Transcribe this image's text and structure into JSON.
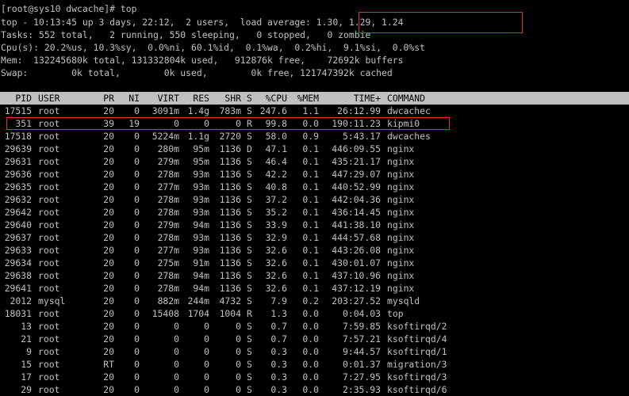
{
  "colors": {
    "background": "#000000",
    "text": "#c0c0c0",
    "header_bg": "#c0c0c0",
    "header_text": "#000000",
    "highlight": "#e03030"
  },
  "prompt": "[root@sys10 dwcache]# top",
  "summary": {
    "top_line": "top - 10:13:45 up 3 days, 22:12,  2 users,  load average: 1.30, 1.29, 1.24",
    "tasks_line": "Tasks: 552 total,   2 running, 550 sleeping,   0 stopped,   0 zombie",
    "cpu_line": "Cpu(s): 20.2%us, 10.3%sy,  0.0%ni, 60.1%id,  0.1%wa,  0.2%hi,  9.1%si,  0.0%st",
    "mem_line": "Mem:  132245680k total, 131332804k used,   912876k free,    72692k buffers",
    "swap_line": "Swap:        0k total,        0k used,        0k free, 121747392k cached"
  },
  "columns": [
    "PID",
    "USER",
    "PR",
    "NI",
    "VIRT",
    "RES",
    "SHR",
    "S",
    "%CPU",
    "%MEM",
    "TIME+",
    "COMMAND"
  ],
  "processes": [
    {
      "pid": "17515",
      "user": "root",
      "pr": "20",
      "ni": "0",
      "virt": "3091m",
      "res": "1.4g",
      "shr": "783m",
      "s": "S",
      "cpu": "247.6",
      "mem": "1.1",
      "time": "26:12.99",
      "command": "dwcachec"
    },
    {
      "pid": "351",
      "user": "root",
      "pr": "39",
      "ni": "19",
      "virt": "0",
      "res": "0",
      "shr": "0",
      "s": "R",
      "cpu": "99.8",
      "mem": "0.0",
      "time": "190:11.23",
      "command": "kipmi0"
    },
    {
      "pid": "17518",
      "user": "root",
      "pr": "20",
      "ni": "0",
      "virt": "5224m",
      "res": "1.1g",
      "shr": "2720",
      "s": "S",
      "cpu": "58.0",
      "mem": "0.9",
      "time": "5:43.17",
      "command": "dwcaches"
    },
    {
      "pid": "29639",
      "user": "root",
      "pr": "20",
      "ni": "0",
      "virt": "280m",
      "res": "95m",
      "shr": "1136",
      "s": "D",
      "cpu": "47.1",
      "mem": "0.1",
      "time": "446:09.55",
      "command": "nginx"
    },
    {
      "pid": "29631",
      "user": "root",
      "pr": "20",
      "ni": "0",
      "virt": "279m",
      "res": "95m",
      "shr": "1136",
      "s": "S",
      "cpu": "46.4",
      "mem": "0.1",
      "time": "435:21.17",
      "command": "nginx"
    },
    {
      "pid": "29636",
      "user": "root",
      "pr": "20",
      "ni": "0",
      "virt": "278m",
      "res": "93m",
      "shr": "1136",
      "s": "S",
      "cpu": "42.2",
      "mem": "0.1",
      "time": "447:29.07",
      "command": "nginx"
    },
    {
      "pid": "29635",
      "user": "root",
      "pr": "20",
      "ni": "0",
      "virt": "277m",
      "res": "93m",
      "shr": "1136",
      "s": "S",
      "cpu": "40.8",
      "mem": "0.1",
      "time": "440:52.99",
      "command": "nginx"
    },
    {
      "pid": "29632",
      "user": "root",
      "pr": "20",
      "ni": "0",
      "virt": "278m",
      "res": "93m",
      "shr": "1136",
      "s": "S",
      "cpu": "37.2",
      "mem": "0.1",
      "time": "442:04.36",
      "command": "nginx"
    },
    {
      "pid": "29642",
      "user": "root",
      "pr": "20",
      "ni": "0",
      "virt": "278m",
      "res": "93m",
      "shr": "1136",
      "s": "S",
      "cpu": "35.2",
      "mem": "0.1",
      "time": "436:14.45",
      "command": "nginx"
    },
    {
      "pid": "29640",
      "user": "root",
      "pr": "20",
      "ni": "0",
      "virt": "279m",
      "res": "94m",
      "shr": "1136",
      "s": "S",
      "cpu": "33.9",
      "mem": "0.1",
      "time": "441:38.10",
      "command": "nginx"
    },
    {
      "pid": "29637",
      "user": "root",
      "pr": "20",
      "ni": "0",
      "virt": "278m",
      "res": "93m",
      "shr": "1136",
      "s": "S",
      "cpu": "32.9",
      "mem": "0.1",
      "time": "444:57.68",
      "command": "nginx"
    },
    {
      "pid": "29633",
      "user": "root",
      "pr": "20",
      "ni": "0",
      "virt": "277m",
      "res": "93m",
      "shr": "1136",
      "s": "S",
      "cpu": "32.6",
      "mem": "0.1",
      "time": "443:26.08",
      "command": "nginx"
    },
    {
      "pid": "29634",
      "user": "root",
      "pr": "20",
      "ni": "0",
      "virt": "275m",
      "res": "91m",
      "shr": "1136",
      "s": "S",
      "cpu": "32.6",
      "mem": "0.1",
      "time": "430:01.07",
      "command": "nginx"
    },
    {
      "pid": "29638",
      "user": "root",
      "pr": "20",
      "ni": "0",
      "virt": "278m",
      "res": "94m",
      "shr": "1136",
      "s": "S",
      "cpu": "32.6",
      "mem": "0.1",
      "time": "437:10.96",
      "command": "nginx"
    },
    {
      "pid": "29641",
      "user": "root",
      "pr": "20",
      "ni": "0",
      "virt": "278m",
      "res": "94m",
      "shr": "1136",
      "s": "S",
      "cpu": "32.6",
      "mem": "0.1",
      "time": "437:12.19",
      "command": "nginx"
    },
    {
      "pid": "2012",
      "user": "mysql",
      "pr": "20",
      "ni": "0",
      "virt": "882m",
      "res": "244m",
      "shr": "4732",
      "s": "S",
      "cpu": "7.9",
      "mem": "0.2",
      "time": "203:27.52",
      "command": "mysqld"
    },
    {
      "pid": "18031",
      "user": "root",
      "pr": "20",
      "ni": "0",
      "virt": "15408",
      "res": "1704",
      "shr": "1004",
      "s": "R",
      "cpu": "1.3",
      "mem": "0.0",
      "time": "0:04.03",
      "command": "top"
    },
    {
      "pid": "13",
      "user": "root",
      "pr": "20",
      "ni": "0",
      "virt": "0",
      "res": "0",
      "shr": "0",
      "s": "S",
      "cpu": "0.7",
      "mem": "0.0",
      "time": "7:59.85",
      "command": "ksoftirqd/2"
    },
    {
      "pid": "21",
      "user": "root",
      "pr": "20",
      "ni": "0",
      "virt": "0",
      "res": "0",
      "shr": "0",
      "s": "S",
      "cpu": "0.7",
      "mem": "0.0",
      "time": "7:57.21",
      "command": "ksoftirqd/4"
    },
    {
      "pid": "9",
      "user": "root",
      "pr": "20",
      "ni": "0",
      "virt": "0",
      "res": "0",
      "shr": "0",
      "s": "S",
      "cpu": "0.3",
      "mem": "0.0",
      "time": "9:44.57",
      "command": "ksoftirqd/1"
    },
    {
      "pid": "15",
      "user": "root",
      "pr": "RT",
      "ni": "0",
      "virt": "0",
      "res": "0",
      "shr": "0",
      "s": "S",
      "cpu": "0.3",
      "mem": "0.0",
      "time": "0:01.37",
      "command": "migration/3"
    },
    {
      "pid": "17",
      "user": "root",
      "pr": "20",
      "ni": "0",
      "virt": "0",
      "res": "0",
      "shr": "0",
      "s": "S",
      "cpu": "0.3",
      "mem": "0.0",
      "time": "7:27.95",
      "command": "ksoftirqd/3"
    },
    {
      "pid": "29",
      "user": "root",
      "pr": "20",
      "ni": "0",
      "virt": "0",
      "res": "0",
      "shr": "0",
      "s": "S",
      "cpu": "0.3",
      "mem": "0.0",
      "time": "2:35.93",
      "command": "ksoftirqd/6"
    }
  ]
}
